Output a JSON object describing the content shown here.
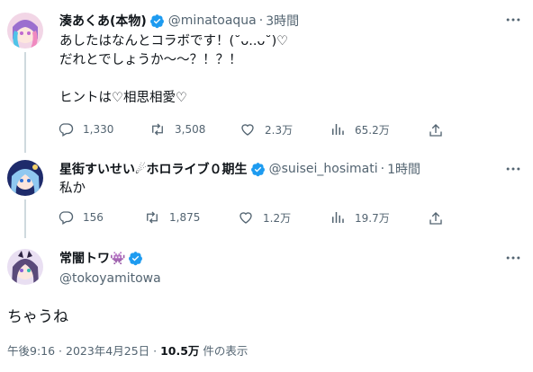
{
  "tweets": [
    {
      "name": "湊あくあ(本物)",
      "handle": "@minatoaqua",
      "dot": "·",
      "time": "3時間",
      "text": "あしたはなんとコラボです！(˘ᴗ..ᴗ˘)♡\nだれとでしょうか〜〜？！？！\n\nヒントは♡相思相愛♡",
      "replies": "1,330",
      "retweets": "3,508",
      "likes": "2.3万",
      "views": "65.2万"
    },
    {
      "name": "星街すいせい☄ホロライブ０期生",
      "handle": "@suisei_hosimati",
      "dot": "·",
      "time": "1時間",
      "text": "私か",
      "replies": "156",
      "retweets": "1,875",
      "likes": "1.2万",
      "views": "19.7万"
    }
  ],
  "main_tweet": {
    "name": "常闇トワ👾",
    "handle": "@tokoyamitowa",
    "text": "ちゃうね",
    "footer_time": "午後9:16 · 2023年4月25日 ·",
    "footer_views": "10.5万",
    "footer_views_label": "件の表示"
  },
  "colors": {
    "verified": "#1d9bf0",
    "text": "#0f1419",
    "secondary": "#536471",
    "thread_line": "#cfd9de"
  },
  "icons": [
    "verified-badge-icon",
    "more-icon",
    "reply-icon",
    "retweet-icon",
    "like-icon",
    "views-icon",
    "share-icon"
  ]
}
